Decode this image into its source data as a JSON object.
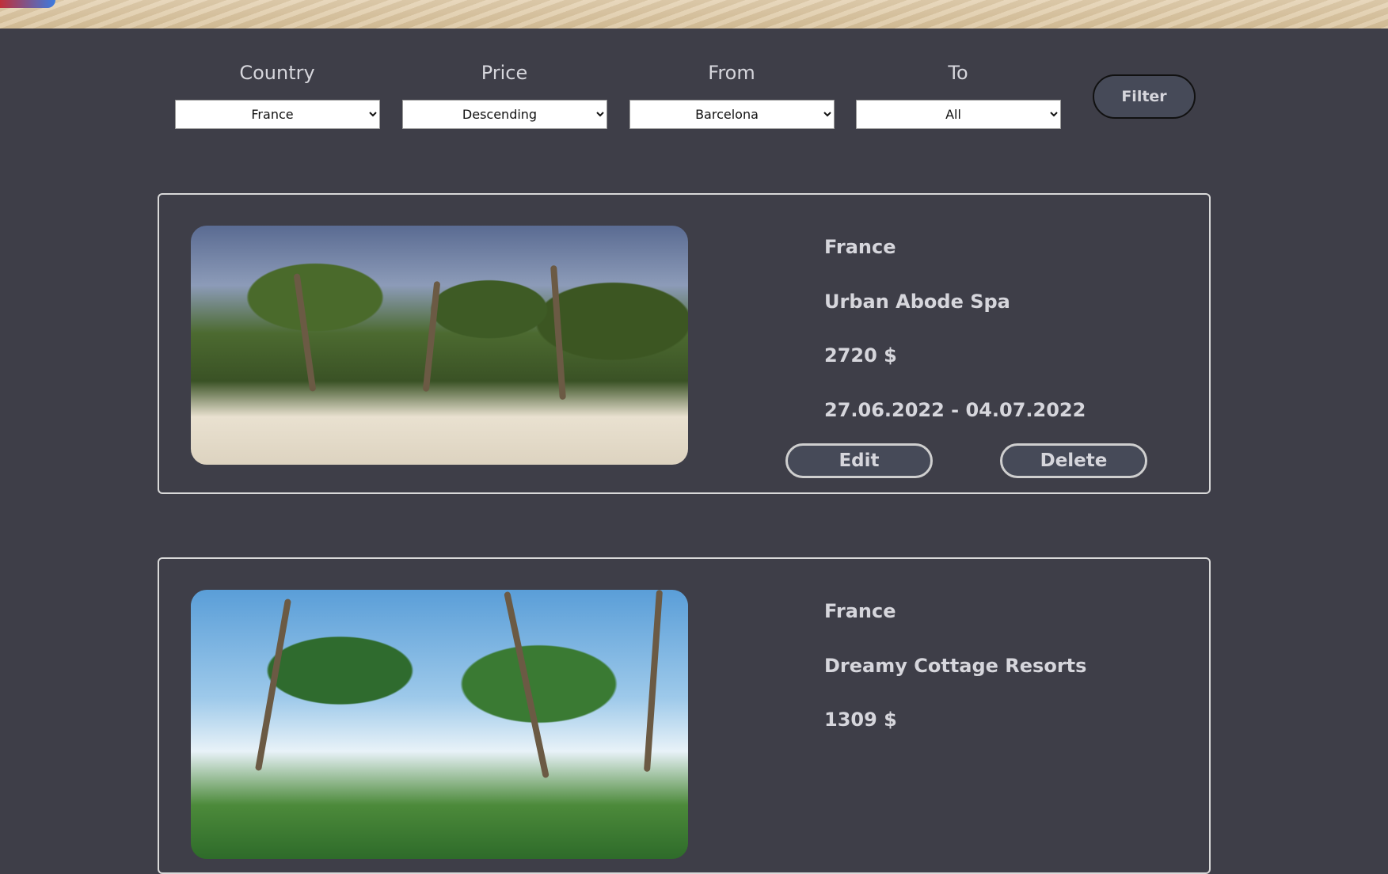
{
  "filters": {
    "country": {
      "label": "Country",
      "value": "France"
    },
    "price": {
      "label": "Price",
      "value": "Descending"
    },
    "from": {
      "label": "From",
      "value": "Barcelona"
    },
    "to": {
      "label": "To",
      "value": "All"
    },
    "filter_button": "Filter"
  },
  "offers": [
    {
      "country": "France",
      "name": "Urban Abode Spa",
      "price": "2720 $",
      "dates": "27.06.2022 - 04.07.2022",
      "edit_label": "Edit",
      "delete_label": "Delete"
    },
    {
      "country": "France",
      "name": "Dreamy Cottage Resorts",
      "price": "1309 $"
    }
  ]
}
